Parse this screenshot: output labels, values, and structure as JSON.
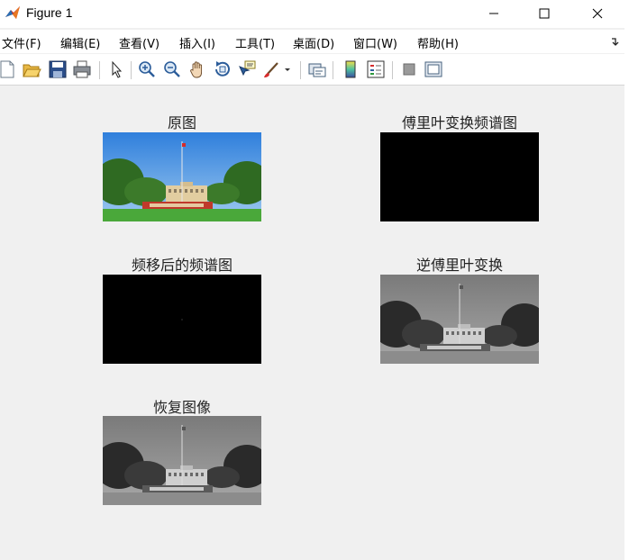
{
  "window": {
    "title": "Figure 1"
  },
  "menubar": {
    "items": [
      {
        "label": "文件(F)"
      },
      {
        "label": "编辑(E)"
      },
      {
        "label": "查看(V)"
      },
      {
        "label": "插入(I)"
      },
      {
        "label": "工具(T)"
      },
      {
        "label": "桌面(D)"
      },
      {
        "label": "窗口(W)"
      },
      {
        "label": "帮助(H)"
      }
    ]
  },
  "toolbar": {
    "icons": [
      "new-figure-icon",
      "open-file-icon",
      "save-icon",
      "print-icon",
      "select-arrow-icon",
      "zoom-in-icon",
      "zoom-out-icon",
      "pan-hand-icon",
      "rotate-3d-icon",
      "data-cursor-icon",
      "brush-icon",
      "link-plot-icon",
      "colorbar-icon",
      "legend-icon",
      "hide-plot-tools-icon",
      "show-plot-tools-icon"
    ]
  },
  "subplots": [
    {
      "title": "原图",
      "image": "color-campus-photo"
    },
    {
      "title": "傅里叶变换频谱图",
      "image": "black-spectrum"
    },
    {
      "title": "频移后的频谱图",
      "image": "black-shifted-spectrum"
    },
    {
      "title": "逆傅里叶变换",
      "image": "grayscale-campus-photo"
    },
    {
      "title": "恢复图像",
      "image": "grayscale-campus-photo"
    }
  ],
  "colors": {
    "figure_bg": "#f0f0f0",
    "sky_blue": "#3f8fe0",
    "grass_green": "#4aa83a",
    "tree_green": "#2f6a22",
    "sign_red": "#c0392b"
  }
}
